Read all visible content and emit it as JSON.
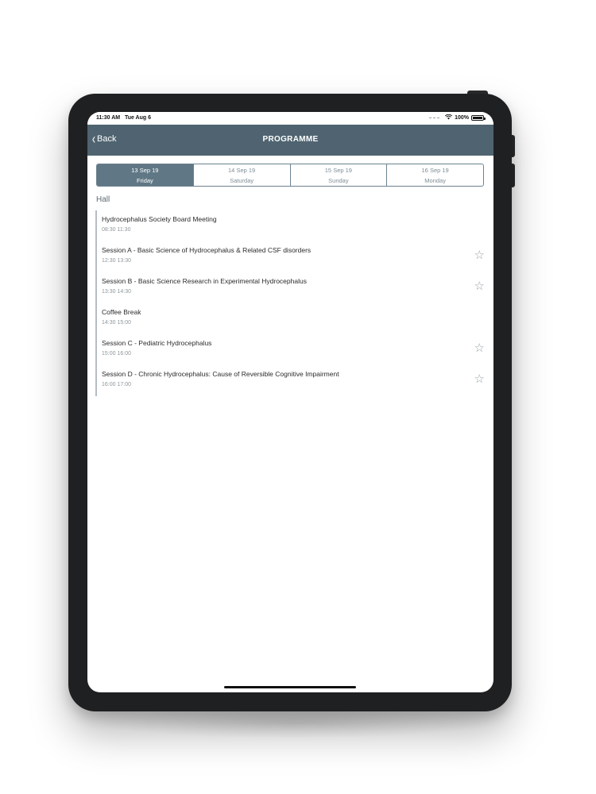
{
  "status_bar": {
    "time": "11:30 AM",
    "date": "Tue Aug 6",
    "battery": "100%",
    "wifi_icon": "wifi-icon",
    "battery_icon": "battery-icon"
  },
  "nav": {
    "back_label": "Back",
    "title": "PROGRAMME"
  },
  "day_tabs": [
    {
      "date": "13 Sep 19",
      "day": "Friday",
      "active": true
    },
    {
      "date": "14 Sep 19",
      "day": "Saturday",
      "active": false
    },
    {
      "date": "15 Sep 19",
      "day": "Sunday",
      "active": false
    },
    {
      "date": "16 Sep 19",
      "day": "Monday",
      "active": false
    }
  ],
  "section": {
    "title": "Hall"
  },
  "sessions": [
    {
      "title": "Hydrocephalus Society Board Meeting",
      "time": "08:30 11:30",
      "favoritable": false
    },
    {
      "title": "Session A - Basic Science of Hydrocephalus & Related CSF disorders",
      "time": "12:30 13:30",
      "favoritable": true
    },
    {
      "title": "Session B - Basic Science Research in Experimental Hydrocephalus",
      "time": "13:30 14:30",
      "favoritable": true
    },
    {
      "title": "Coffee Break",
      "time": "14:30 15:00",
      "favoritable": false
    },
    {
      "title": "Session C - Pediatric Hydrocephalus",
      "time": "15:00 16:00",
      "favoritable": true
    },
    {
      "title": "Session D - Chronic Hydrocephalus: Cause of Reversible Cognitive Impairment",
      "time": "16:00 17:00",
      "favoritable": true
    }
  ],
  "colors": {
    "nav_bar": "#4f6470",
    "active_tab": "#607785",
    "device_frame": "#1f2022"
  }
}
